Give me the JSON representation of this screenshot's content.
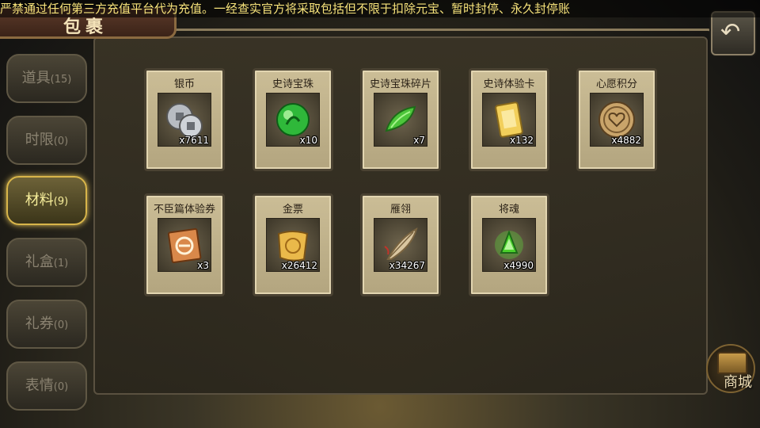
{
  "notice": "严禁通过任何第三方充值平台代为充值。一经查实官方将采取包括但不限于扣除元宝、暂时封停、永久封停账",
  "header": {
    "title": "包裹"
  },
  "tabs": [
    {
      "label": "道具",
      "count": "(15)",
      "active": false
    },
    {
      "label": "时限",
      "count": "(0)",
      "active": false
    },
    {
      "label": "材料",
      "count": "(9)",
      "active": true
    },
    {
      "label": "礼盒",
      "count": "(1)",
      "active": false
    },
    {
      "label": "礼券",
      "count": "(0)",
      "active": false
    },
    {
      "label": "表情",
      "count": "(0)",
      "active": false
    }
  ],
  "items": [
    {
      "name": "银币",
      "qty": "x7611",
      "icon": "silver-coin-icon"
    },
    {
      "name": "史诗宝珠",
      "qty": "x10",
      "icon": "epic-orb-icon"
    },
    {
      "name": "史诗宝珠碎片",
      "qty": "x7",
      "icon": "orb-fragment-icon"
    },
    {
      "name": "史诗体验卡",
      "qty": "x132",
      "icon": "trial-card-icon"
    },
    {
      "name": "心愿积分",
      "qty": "x4882",
      "icon": "wish-coin-icon"
    },
    {
      "name": "不臣篇体验券",
      "qty": "x3",
      "icon": "trial-ticket-icon"
    },
    {
      "name": "金票",
      "qty": "x26412",
      "icon": "gold-ticket-icon"
    },
    {
      "name": "雁翎",
      "qty": "x34267",
      "icon": "feather-icon"
    },
    {
      "name": "将魂",
      "qty": "x4990",
      "icon": "general-soul-icon"
    }
  ],
  "shop": {
    "label": "商城"
  },
  "colors": {
    "active_tab_border": "#d8b54a",
    "notice_text": "#f6e27a",
    "card_bg": "#cbbd96"
  }
}
